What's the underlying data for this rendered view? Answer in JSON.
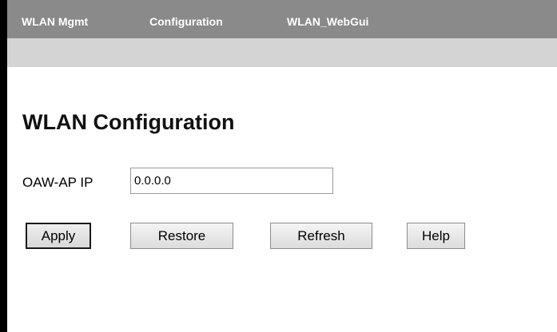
{
  "nav": {
    "items": [
      {
        "label": "WLAN Mgmt"
      },
      {
        "label": "Configuration"
      },
      {
        "label": "WLAN_WebGui"
      }
    ]
  },
  "page": {
    "title": "WLAN Configuration"
  },
  "form": {
    "ip_label": "OAW-AP IP",
    "ip_value": "0.0.0.0"
  },
  "buttons": {
    "apply": "Apply",
    "restore": "Restore",
    "refresh": "Refresh",
    "help": "Help"
  }
}
